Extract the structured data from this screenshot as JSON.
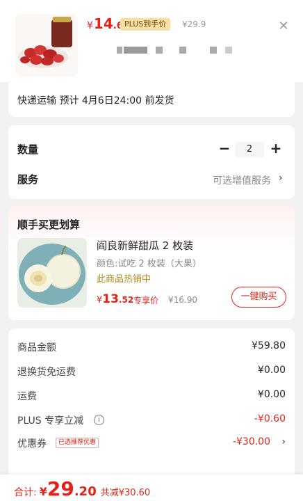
{
  "header": {
    "price": {
      "currency": "¥",
      "integer": "14",
      "decimal": ".6"
    },
    "plus_badge": "PLUS到手价",
    "original_price": "¥29.9",
    "close_icon": "close-icon"
  },
  "shipping": {
    "text": "快递运输 预计 4月6日24:00 前发货"
  },
  "quantity": {
    "label": "数量",
    "value": "2",
    "minus": "−",
    "plus": "+"
  },
  "service": {
    "label": "服务",
    "value": "可选增值服务",
    "chevron": "›"
  },
  "recommend": {
    "title": "顺手买更划算",
    "product_name": "阎良新鲜甜瓜 2 枚装",
    "spec": "颜色:试吃 2 枚装（大果）",
    "hot": "此商品热销中",
    "price": {
      "currency": "¥",
      "integer": "13",
      "decimal": ".52"
    },
    "price_tag": "专享价",
    "original_price": "¥16.90",
    "buy_button": "一键购买"
  },
  "summary": {
    "rows": [
      {
        "label": "商品金额",
        "value": "¥59.80"
      },
      {
        "label": "退换货免运费",
        "value": "¥0.00"
      },
      {
        "label": "运费",
        "value": "¥0.00"
      },
      {
        "label": "PLUS 专享立减",
        "value": "-¥0.60"
      },
      {
        "label": "优惠券",
        "value": "-¥30.00",
        "tag": "已选推荐优惠"
      }
    ],
    "info_icon": "info-icon",
    "chevron": "›"
  },
  "total": {
    "label": "合计:",
    "currency": "¥",
    "integer": "29",
    "decimal": ".20",
    "saving": "共减¥30.60"
  },
  "colors": {
    "accent": "#e2231a",
    "plus_badge_bg": "#f5dfa5",
    "hot_text": "#b38a1a"
  }
}
